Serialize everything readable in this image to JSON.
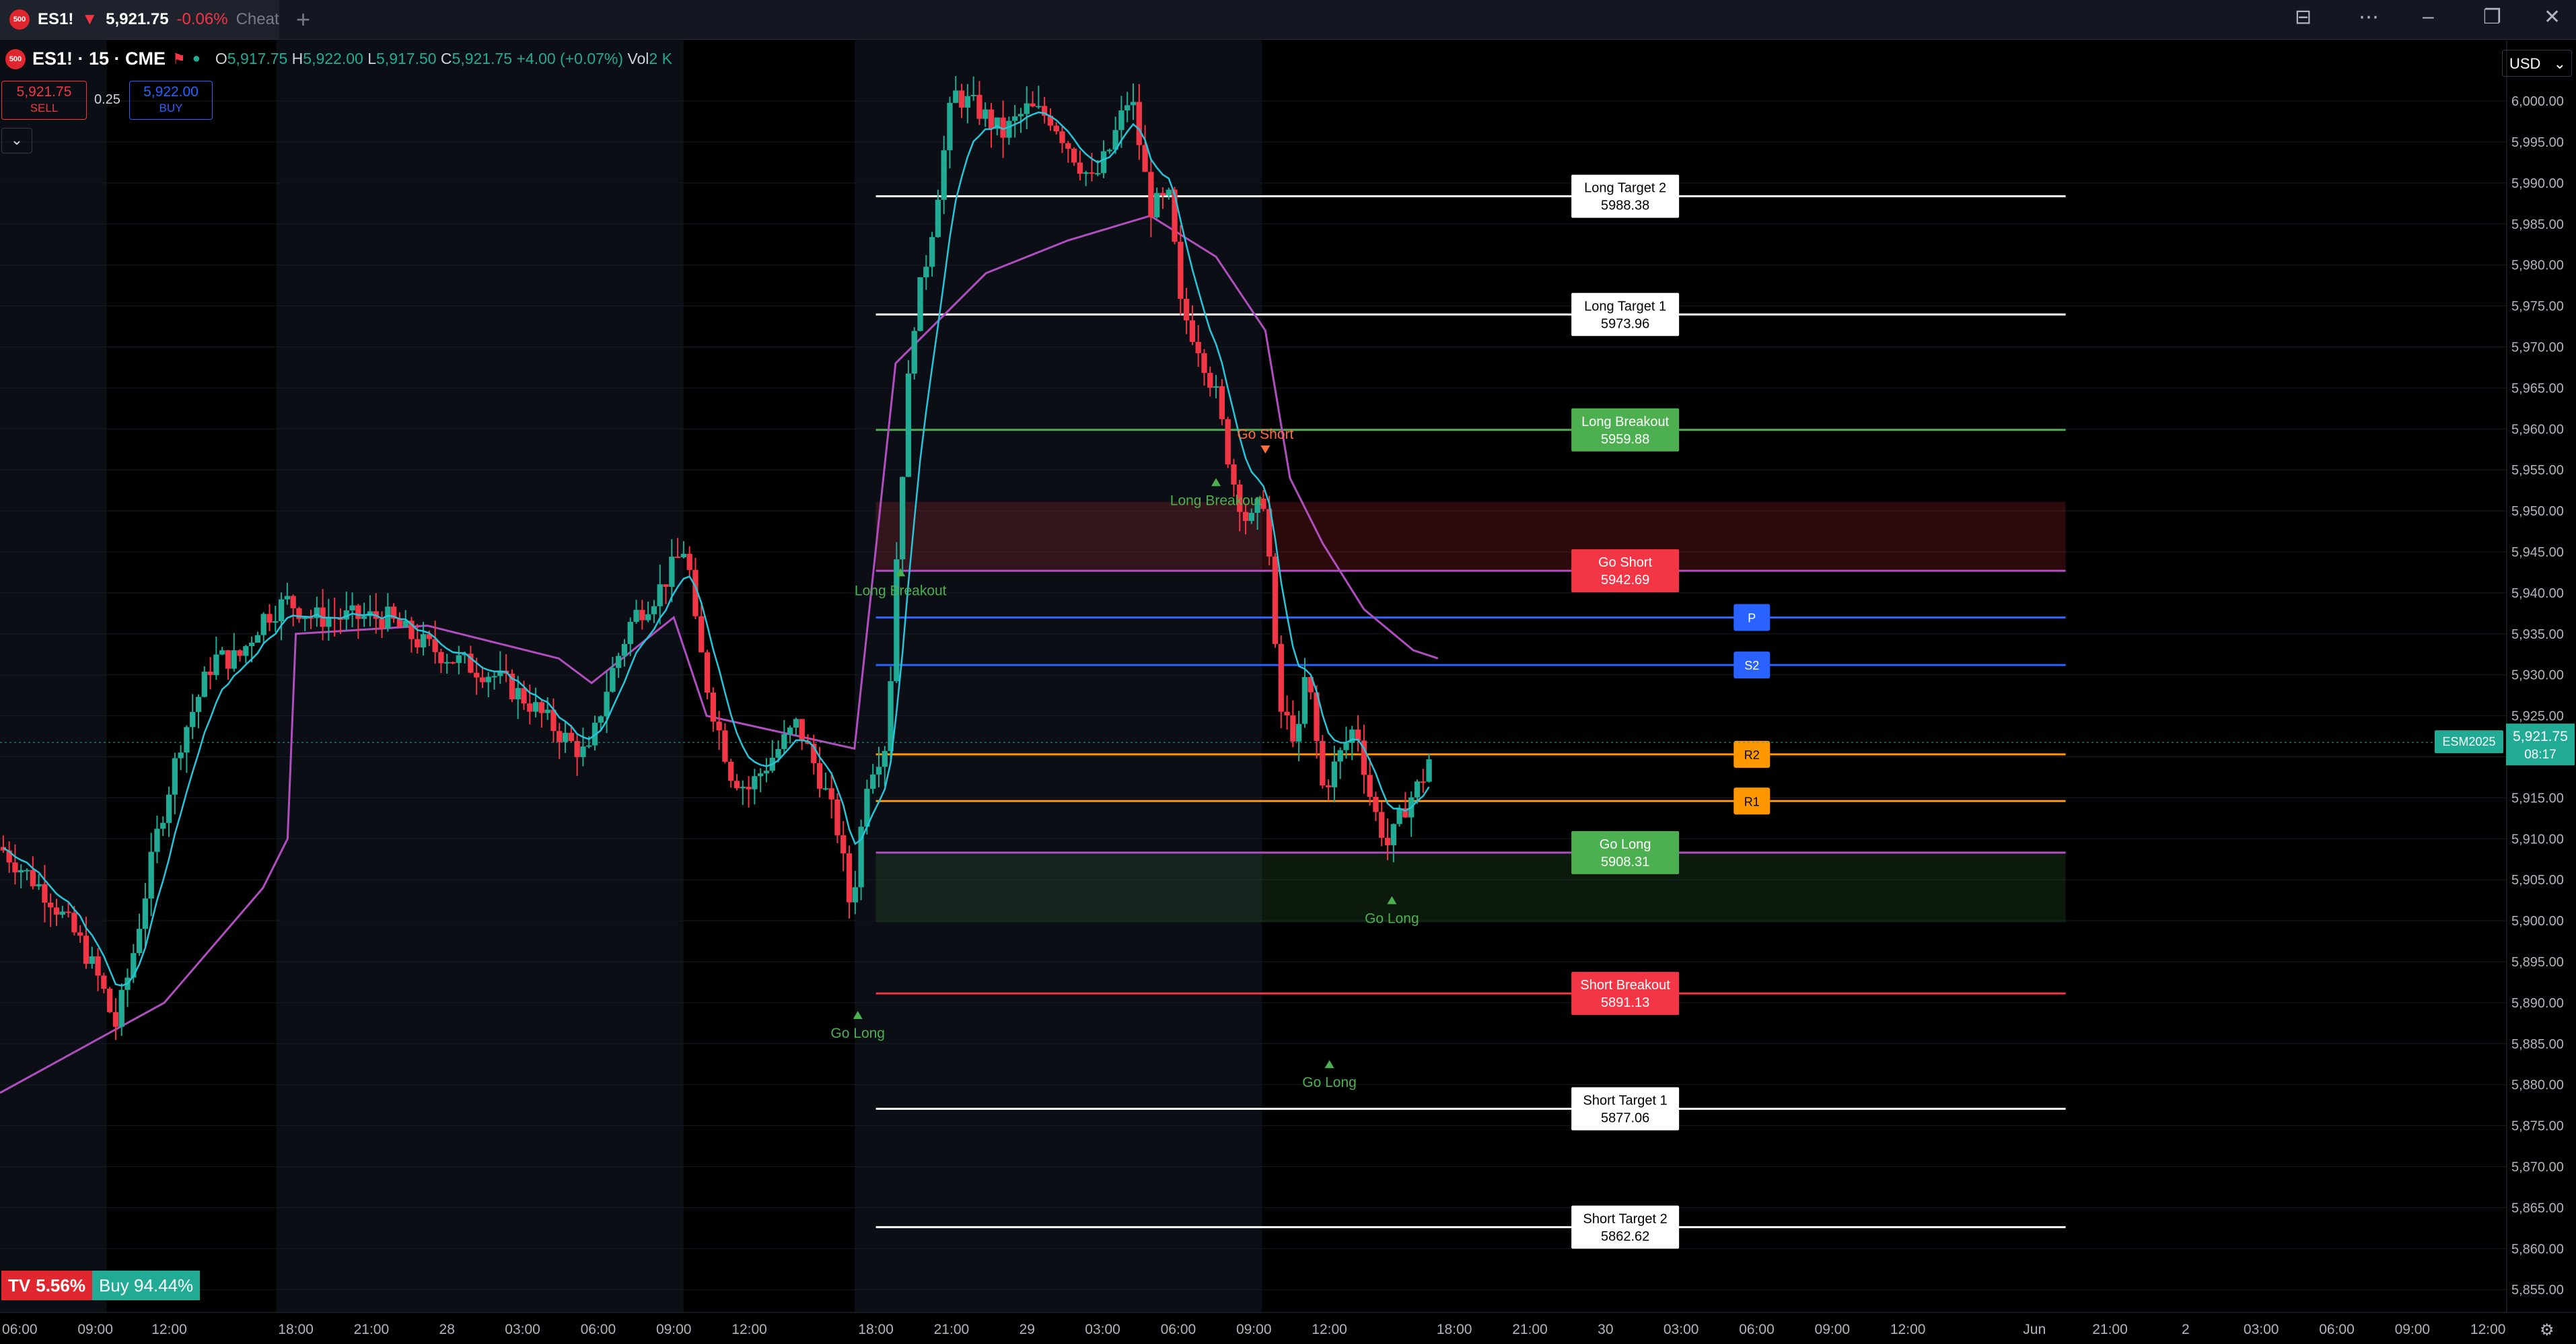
{
  "tab": {
    "symbol": "ES1!",
    "price": "5,921.75",
    "change": "-0.06%",
    "subtitle": "Cheat",
    "logo": "500"
  },
  "legend": {
    "title": "ES1! · 15 · CME",
    "O": "5,917.75",
    "H": "5,922.00",
    "L": "5,917.50",
    "C": "5,921.75",
    "chg": "+4.00 (+0.07%)",
    "vol_label": "Vol",
    "vol": "2 K"
  },
  "trade": {
    "sell_price": "5,921.75",
    "sell_label": "SELL",
    "buy_price": "5,922.00",
    "buy_label": "BUY",
    "spread": "0.25"
  },
  "currency": "USD",
  "sentiment": {
    "sell_pct": "5.56%",
    "buy": "Buy 94.44%"
  },
  "colors": {
    "up": "#22ab94",
    "down": "#f23645",
    "white": "#ffffff",
    "green": "#4caf50",
    "red": "#f23645",
    "purple": "#b04ec0",
    "cyan": "#26c6da",
    "blue": "#2962ff",
    "orange": "#ff9800"
  },
  "chart_data": {
    "type": "candlestick",
    "symbol": "ES1!",
    "timeframe": "15",
    "ylim": [
      5851,
      6008
    ],
    "y_ticks": [
      5855,
      5860,
      5865,
      5870,
      5875,
      5880,
      5885,
      5890,
      5895,
      5900,
      5905,
      5910,
      5915,
      5920,
      5925,
      5930,
      5935,
      5940,
      5945,
      5950,
      5955,
      5960,
      5965,
      5970,
      5975,
      5980,
      5985,
      5990,
      5995,
      6000
    ],
    "x_ticks": [
      "06:00",
      "09:00",
      "12:00",
      "18:00",
      "21:00",
      "28",
      "03:00",
      "06:00",
      "09:00",
      "12:00",
      "18:00",
      "21:00",
      "29",
      "03:00",
      "06:00",
      "09:00",
      "12:00",
      "18:00",
      "21:00",
      "30",
      "03:00",
      "06:00",
      "09:00",
      "12:00",
      "Jun",
      "21:00",
      "2",
      "03:00",
      "06:00",
      "09:00",
      "12:00"
    ],
    "price_path": [
      [
        0,
        5909
      ],
      [
        30,
        5903
      ],
      [
        50,
        5897
      ],
      [
        62,
        5892
      ],
      [
        70,
        5887
      ],
      [
        80,
        5895
      ],
      [
        95,
        5910
      ],
      [
        110,
        5922
      ],
      [
        130,
        5932
      ],
      [
        145,
        5932
      ],
      [
        160,
        5937
      ],
      [
        175,
        5939
      ],
      [
        190,
        5937
      ],
      [
        215,
        5937
      ],
      [
        235,
        5937
      ],
      [
        255,
        5934
      ],
      [
        275,
        5932
      ],
      [
        300,
        5930
      ],
      [
        320,
        5927
      ],
      [
        345,
        5922
      ],
      [
        358,
        5920
      ],
      [
        370,
        5929
      ],
      [
        385,
        5937
      ],
      [
        400,
        5940
      ],
      [
        418,
        5946
      ],
      [
        422,
        5937
      ],
      [
        432,
        5927
      ],
      [
        445,
        5918
      ],
      [
        455,
        5916
      ],
      [
        470,
        5920
      ],
      [
        485,
        5924
      ],
      [
        500,
        5917
      ],
      [
        510,
        5911
      ],
      [
        518,
        5901
      ],
      [
        528,
        5918
      ],
      [
        540,
        5922
      ],
      [
        546,
        5946
      ],
      [
        555,
        5972
      ],
      [
        566,
        5983
      ],
      [
        573,
        5992
      ],
      [
        580,
        6001
      ],
      [
        595,
        5999
      ],
      [
        610,
        5996
      ],
      [
        625,
        5999
      ],
      [
        640,
        5998
      ],
      [
        655,
        5993
      ],
      [
        665,
        5990
      ],
      [
        675,
        5994
      ],
      [
        688,
        6001
      ],
      [
        700,
        5987
      ],
      [
        712,
        5988
      ],
      [
        718,
        5975
      ],
      [
        730,
        5970
      ],
      [
        740,
        5964
      ],
      [
        750,
        5954
      ],
      [
        760,
        5948
      ],
      [
        770,
        5952
      ],
      [
        778,
        5926
      ],
      [
        790,
        5922
      ],
      [
        795,
        5931
      ],
      [
        805,
        5916
      ],
      [
        815,
        5920
      ],
      [
        825,
        5924
      ],
      [
        835,
        5914
      ],
      [
        845,
        5909
      ],
      [
        855,
        5914
      ],
      [
        865,
        5917
      ],
      [
        873,
        5921.75
      ]
    ],
    "session_bands": [
      [
        "05:45",
        "09:00",
        "night"
      ],
      [
        "09:00",
        "16:00",
        "day"
      ],
      [
        "16:00",
        "09:00",
        "night"
      ],
      [
        "09:00",
        "16:00",
        "day"
      ],
      [
        "16:00",
        "09:00",
        "night"
      ],
      [
        "09:00",
        "16:00",
        "day"
      ]
    ],
    "vwap_line": [
      [
        0,
        5879
      ],
      [
        100,
        5890
      ],
      [
        160,
        5904
      ],
      [
        175,
        5910
      ],
      [
        180,
        5935
      ],
      [
        260,
        5936
      ],
      [
        340,
        5932
      ],
      [
        360,
        5929
      ],
      [
        410,
        5937
      ],
      [
        430,
        5925
      ],
      [
        520,
        5921
      ],
      [
        545,
        5968
      ],
      [
        600,
        5979
      ],
      [
        650,
        5983
      ],
      [
        700,
        5986
      ],
      [
        740,
        5981
      ],
      [
        770,
        5972
      ],
      [
        785,
        5954
      ],
      [
        805,
        5946
      ],
      [
        830,
        5938
      ],
      [
        860,
        5933
      ],
      [
        875,
        5932
      ]
    ],
    "levels": [
      {
        "label": "Long Target 2",
        "value": 5988.38,
        "color": "white"
      },
      {
        "label": "Long Target 1",
        "value": 5973.96,
        "color": "white"
      },
      {
        "label": "Long Breakout",
        "value": 5959.88,
        "color": "green"
      },
      {
        "label": "Go Short",
        "value": 5942.69,
        "color": "red"
      },
      {
        "label": "Go Long",
        "value": 5908.31,
        "color": "green"
      },
      {
        "label": "Short Breakout",
        "value": 5891.13,
        "color": "red"
      },
      {
        "label": "Short Target 1",
        "value": 5877.06,
        "color": "white"
      },
      {
        "label": "Short Target 2",
        "value": 5862.62,
        "color": "white"
      }
    ],
    "pivots": [
      {
        "label": "P",
        "value": 5937.0,
        "color": "blue"
      },
      {
        "label": "S2",
        "value": 5931.2,
        "color": "blue"
      },
      {
        "label": "R2",
        "value": 5920.3,
        "color": "orange"
      },
      {
        "label": "R1",
        "value": 5914.6,
        "color": "orange"
      }
    ],
    "zones": [
      {
        "from": 5942.69,
        "to": 5951.1,
        "color": "red"
      },
      {
        "from": 5899.8,
        "to": 5908.31,
        "color": "green"
      }
    ],
    "signals": [
      {
        "label": "Long Breakout",
        "at": 548,
        "y": 5943,
        "dir": "up"
      },
      {
        "label": "Long Breakout",
        "at": 740,
        "y": 5954,
        "dir": "up"
      },
      {
        "label": "Go Short",
        "at": 770,
        "y": 5957,
        "dir": "down"
      },
      {
        "label": "Go Long",
        "at": 522,
        "y": 5889,
        "dir": "up"
      },
      {
        "label": "Go Long",
        "at": 809,
        "y": 5883,
        "dir": "up"
      },
      {
        "label": "Go Long",
        "at": 847,
        "y": 5903,
        "dir": "up"
      }
    ],
    "price_tag": {
      "contract": "ESM2025",
      "value": "5,921.75",
      "countdown": "08:17"
    }
  }
}
